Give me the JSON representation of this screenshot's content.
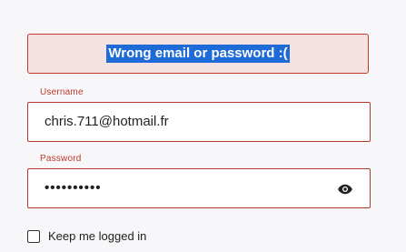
{
  "alert": {
    "message": "Wrong email or password :("
  },
  "username": {
    "label": "Username",
    "value": "chris.711@hotmail.fr"
  },
  "password": {
    "label": "Password",
    "masked_value": "••••••••••",
    "toggle_icon": "eye-icon"
  },
  "remember": {
    "label": "Keep me logged in",
    "checked": false
  },
  "colors": {
    "error": "#c0392b",
    "alert_bg": "#f4e2e2",
    "selection": "#1e6ad6"
  }
}
